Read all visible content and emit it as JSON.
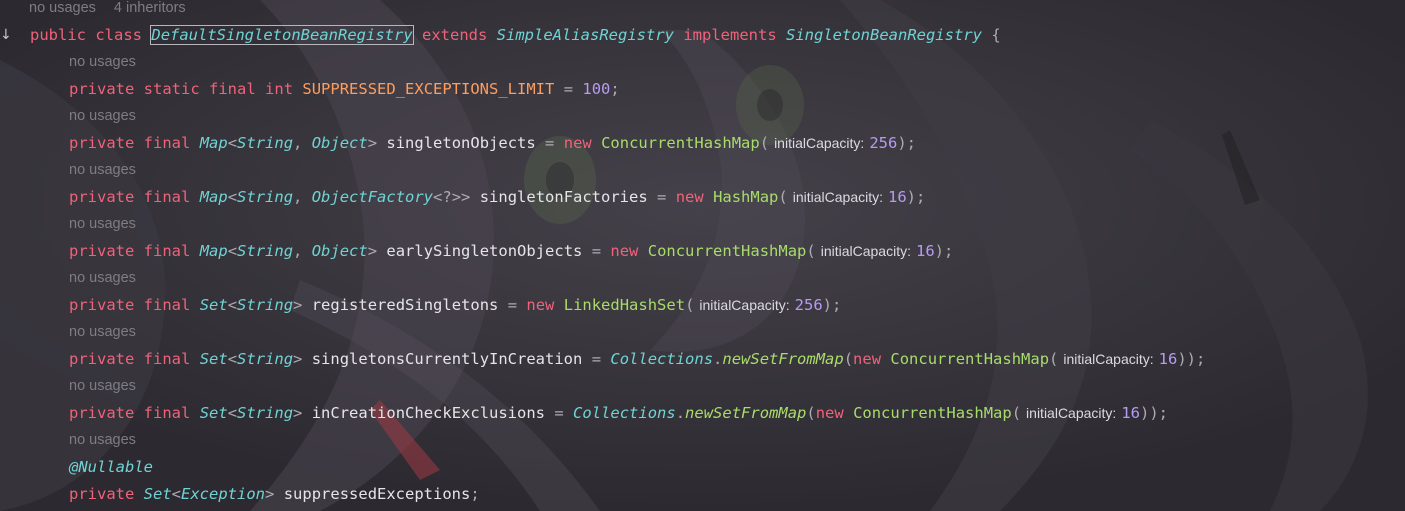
{
  "inlay_header": {
    "usages": "no usages",
    "inheritors": "4 inheritors"
  },
  "gutter": {
    "icon": "implemented-down-arrow-icon",
    "glyph": "↓"
  },
  "class_line": {
    "kw_public": "public",
    "kw_class": "class",
    "class_name": "DefaultSingletonBeanRegistry",
    "kw_extends": "extends",
    "super_name": "SimpleAliasRegistry",
    "kw_implements": "implements",
    "iface_name": "SingletonBeanRegistry",
    "brace": "{"
  },
  "usage_hint": "no usages",
  "fields": [
    {
      "mods": [
        "private",
        "static",
        "final",
        "int"
      ],
      "name": "SUPPRESSED_EXCEPTIONS_LIMIT",
      "value": "100"
    },
    {
      "mods": [
        "private",
        "final"
      ],
      "type": "Map",
      "generic1": "String",
      "generic2": "Object",
      "name": "singletonObjects",
      "new_kw": "new",
      "ctor": "ConcurrentHashMap",
      "param_hint": "initialCapacity:",
      "arg": "256"
    },
    {
      "mods": [
        "private",
        "final"
      ],
      "type": "Map",
      "generic1": "String",
      "generic2": "ObjectFactory",
      "generic2_suffix": "<?>>",
      "name": "singletonFactories",
      "new_kw": "new",
      "ctor": "HashMap",
      "param_hint": "initialCapacity:",
      "arg": "16"
    },
    {
      "mods": [
        "private",
        "final"
      ],
      "type": "Map",
      "generic1": "String",
      "generic2": "Object",
      "name": "earlySingletonObjects",
      "new_kw": "new",
      "ctor": "ConcurrentHashMap",
      "param_hint": "initialCapacity:",
      "arg": "16"
    },
    {
      "mods": [
        "private",
        "final"
      ],
      "type": "Set",
      "generic1": "String",
      "name": "registeredSingletons",
      "new_kw": "new",
      "ctor": "LinkedHashSet",
      "param_hint": "initialCapacity:",
      "arg": "256"
    },
    {
      "mods": [
        "private",
        "final"
      ],
      "type": "Set",
      "generic1": "String",
      "name": "singletonsCurrentlyInCreation",
      "util": "Collections",
      "util_method": "newSetFromMap",
      "new_kw": "new",
      "ctor": "ConcurrentHashMap",
      "param_hint": "initialCapacity:",
      "arg": "16"
    },
    {
      "mods": [
        "private",
        "final"
      ],
      "type": "Set",
      "generic1": "String",
      "name": "inCreationCheckExclusions",
      "util": "Collections",
      "util_method": "newSetFromMap",
      "new_kw": "new",
      "ctor": "ConcurrentHashMap",
      "param_hint": "initialCapacity:",
      "arg": "16"
    },
    {
      "annotation": "@Nullable",
      "mods": [
        "private"
      ],
      "type": "Set",
      "generic1": "Exception",
      "name": "suppressedExceptions"
    }
  ],
  "colors": {
    "background": "#2f2d33",
    "keyword": "#f0627a",
    "type": "#6fd3d4",
    "class": "#a8dc6a",
    "number": "#b79bf2",
    "constant": "#ff9d5c",
    "identifier": "#e6e4e8",
    "hint": "#7f7c84"
  }
}
